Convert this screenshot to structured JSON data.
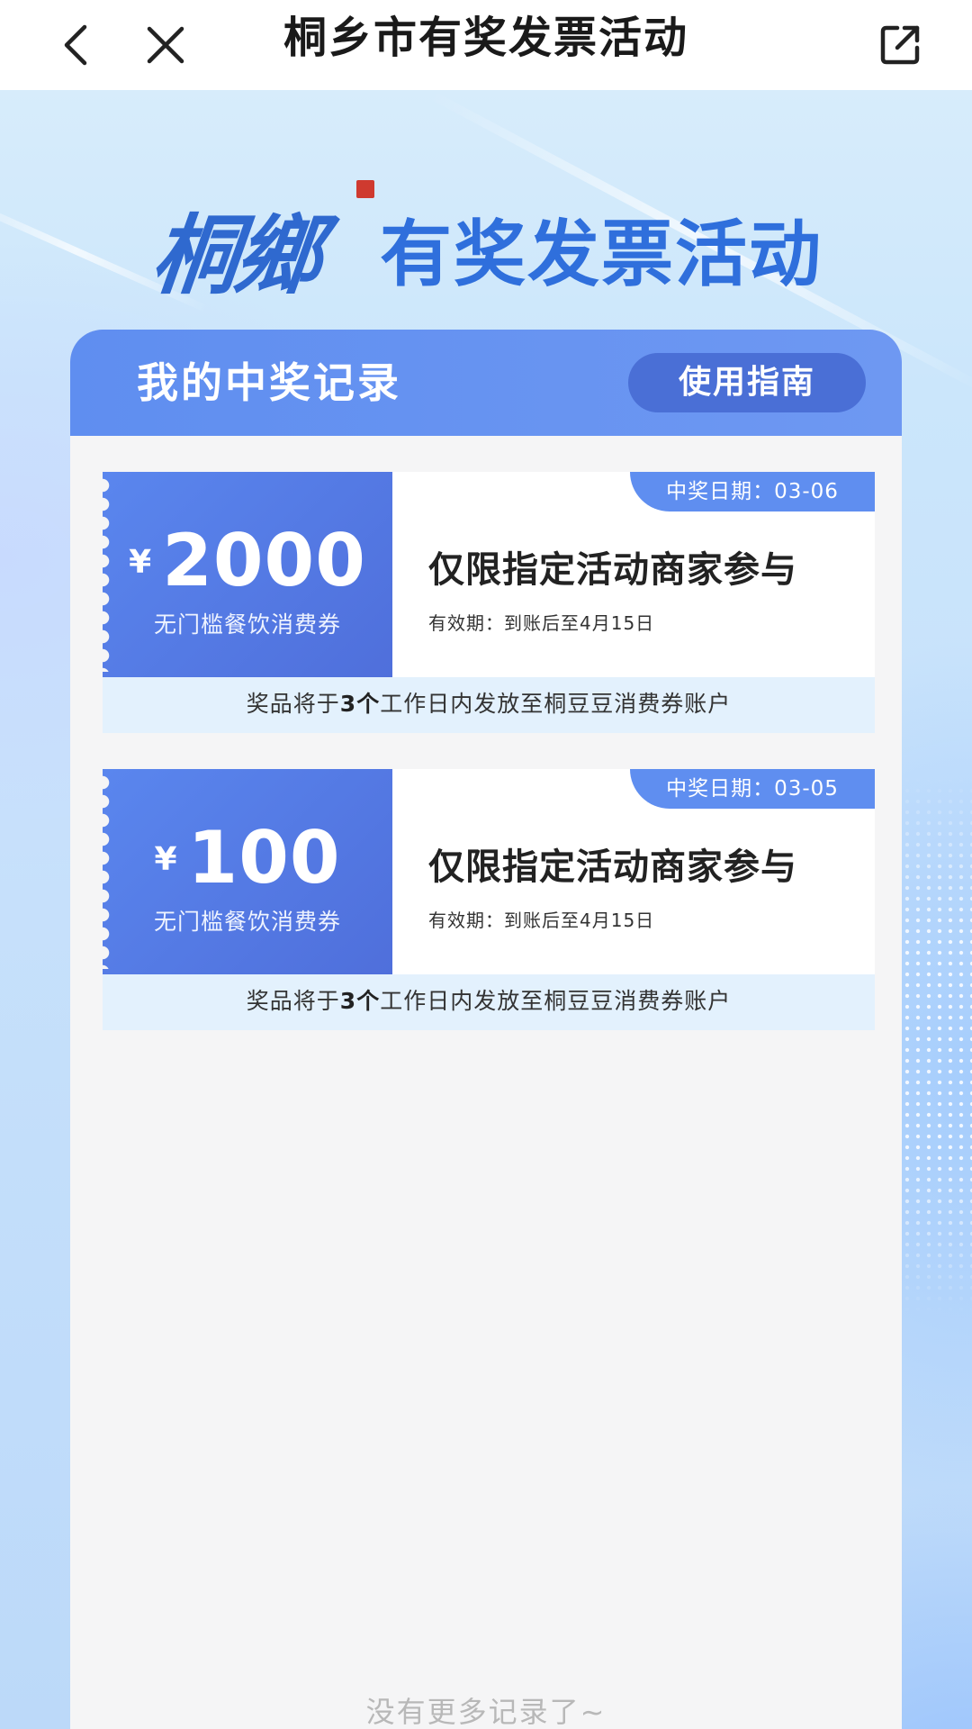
{
  "nav": {
    "title": "桐乡市有奖发票活动",
    "back_icon": "chevron-left-icon",
    "close_icon": "close-icon",
    "share_icon": "share-external-icon"
  },
  "logo": {
    "calligraphy": "桐鄉",
    "text": "有奖发票活动"
  },
  "panel": {
    "title": "我的中奖记录",
    "guide_button": "使用指南"
  },
  "coupons": [
    {
      "currency": "¥",
      "amount": "2000",
      "type": "无门槛餐饮消费券",
      "date_label": "中奖日期：03-06",
      "description": "仅限指定活动商家参与",
      "validity": "有效期：到账后至4月15日",
      "footer_pre": "奖品将于",
      "footer_bold": "3个",
      "footer_post": "工作日内发放至桐豆豆消费券账户"
    },
    {
      "currency": "¥",
      "amount": "100",
      "type": "无门槛餐饮消费券",
      "date_label": "中奖日期：03-05",
      "description": "仅限指定活动商家参与",
      "validity": "有效期：到账后至4月15日",
      "footer_pre": "奖品将于",
      "footer_bold": "3个",
      "footer_post": "工作日内发放至桐豆豆消费券账户"
    }
  ],
  "footer": {
    "no_more": "没有更多记录了~"
  },
  "colors": {
    "accent": "#5f8ef0",
    "button": "#4a6fd6",
    "coupon_left": "#5a86ee",
    "coupon_footer_bg": "#e3f1fd"
  }
}
